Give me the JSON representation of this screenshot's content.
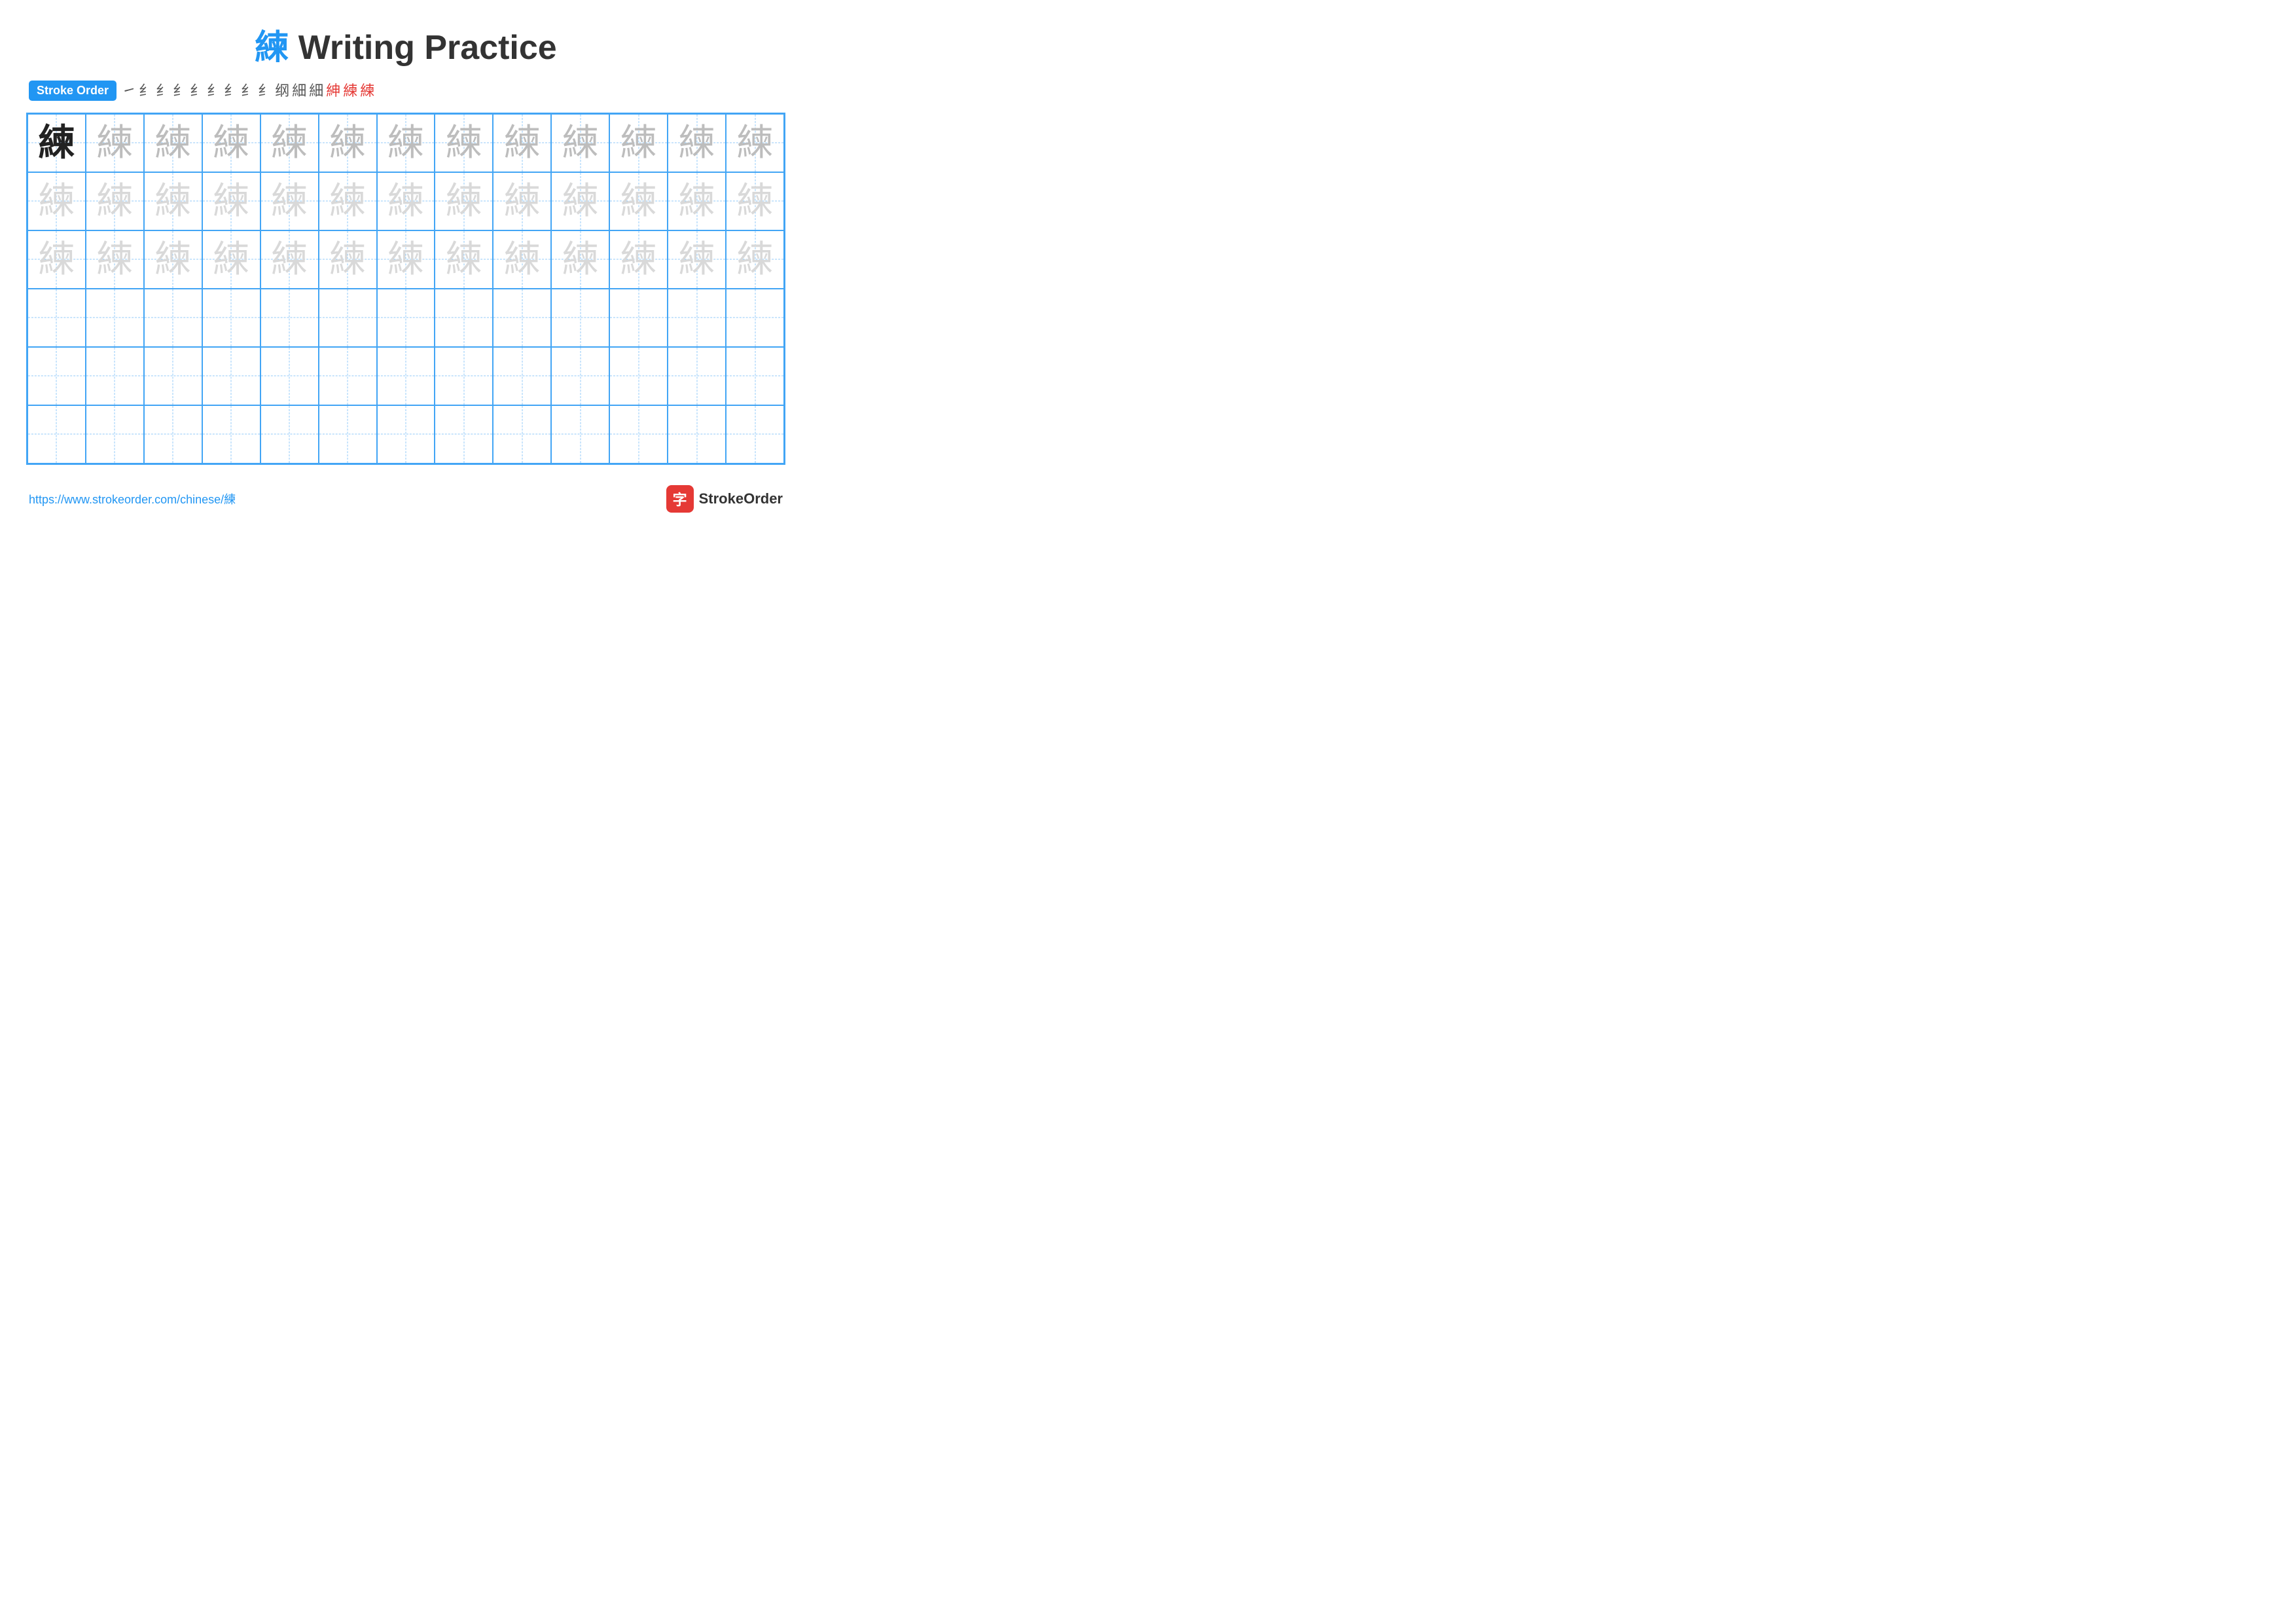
{
  "title": {
    "char": "練",
    "text": " Writing Practice"
  },
  "stroke_order": {
    "badge_label": "Stroke Order",
    "steps": [
      {
        "char": "㇀",
        "red": false
      },
      {
        "char": "纟",
        "red": false
      },
      {
        "char": "纟",
        "red": false
      },
      {
        "char": "纟",
        "red": false
      },
      {
        "char": "纟",
        "red": false
      },
      {
        "char": "纟",
        "red": false
      },
      {
        "char": "纟",
        "red": false
      },
      {
        "char": "纟",
        "red": false
      },
      {
        "char": "糿",
        "red": false
      },
      {
        "char": "糿",
        "red": false
      },
      {
        "char": "绤",
        "red": false
      },
      {
        "char": "細",
        "red": false
      },
      {
        "char": "紳",
        "red": true
      },
      {
        "char": "練",
        "red": true
      },
      {
        "char": "練",
        "red": true
      }
    ]
  },
  "grid": {
    "rows": 6,
    "cols": 13,
    "char": "練",
    "row_styles": [
      [
        "dark",
        "medium-gray",
        "medium-gray",
        "medium-gray",
        "medium-gray",
        "medium-gray",
        "medium-gray",
        "medium-gray",
        "medium-gray",
        "medium-gray",
        "medium-gray",
        "medium-gray",
        "medium-gray"
      ],
      [
        "light-gray",
        "light-gray",
        "light-gray",
        "light-gray",
        "light-gray",
        "light-gray",
        "light-gray",
        "light-gray",
        "light-gray",
        "light-gray",
        "light-gray",
        "light-gray",
        "light-gray"
      ],
      [
        "light-gray",
        "light-gray",
        "light-gray",
        "light-gray",
        "light-gray",
        "light-gray",
        "light-gray",
        "light-gray",
        "light-gray",
        "light-gray",
        "light-gray",
        "light-gray",
        "light-gray"
      ],
      [
        "empty",
        "empty",
        "empty",
        "empty",
        "empty",
        "empty",
        "empty",
        "empty",
        "empty",
        "empty",
        "empty",
        "empty",
        "empty"
      ],
      [
        "empty",
        "empty",
        "empty",
        "empty",
        "empty",
        "empty",
        "empty",
        "empty",
        "empty",
        "empty",
        "empty",
        "empty",
        "empty"
      ],
      [
        "empty",
        "empty",
        "empty",
        "empty",
        "empty",
        "empty",
        "empty",
        "empty",
        "empty",
        "empty",
        "empty",
        "empty",
        "empty"
      ]
    ]
  },
  "footer": {
    "url": "https://www.strokeorder.com/chinese/練",
    "brand_name": "StrokeOrder",
    "brand_icon_char": "字"
  }
}
